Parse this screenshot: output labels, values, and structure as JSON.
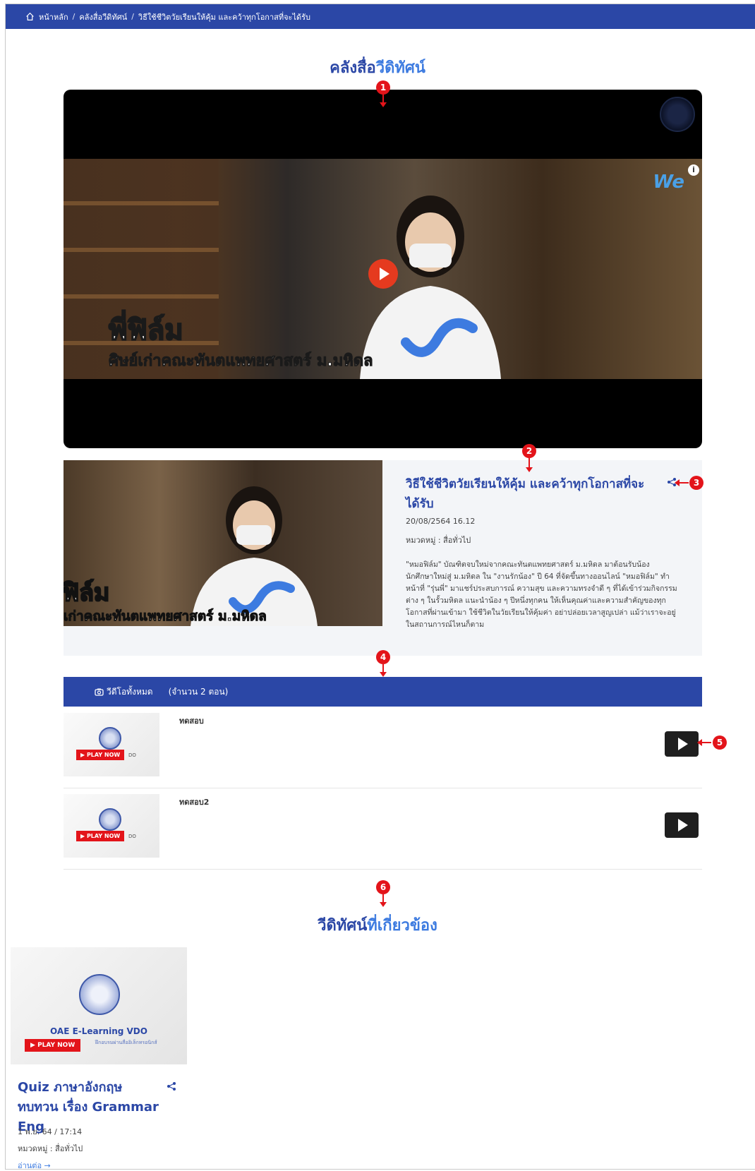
{
  "breadcrumb": {
    "home": "หน้าหลัก",
    "separator": "/",
    "library": "คลังสื่อวีดิทัศน์",
    "current": "วิธีใช้ชีวิตวัยเรียนให้คุ้ม และคว้าทุกโอกาสที่จะได้รับ"
  },
  "page_heading": {
    "part1": "คลังสื่อ",
    "part2": "วีดิทัศน์"
  },
  "player": {
    "caption_line1": "พี่ฟิล์ม",
    "caption_line2": "ศิษย์เก่าคณะทันตแพทยศาสตร์ ม.มหิดล",
    "brand": "We",
    "info": "i"
  },
  "video_detail": {
    "title": "วิธีใช้ชีวิตวัยเรียนให้คุ้ม และคว้าทุกโอกาสที่จะได้รับ",
    "date": "20/08/2564 16.12",
    "category": "หมวดหมู่ : สื่อทั่วไป",
    "description": "\"หมอฟิล์ม\" บัณฑิตจบใหม่จากคณะทันตแพทยศาสตร์ ม.มหิดล มาต้อนรับน้องนักศึกษาใหม่สู่ ม.มหิดล ใน \"งานรักน้อง\" ปี 64 ที่จัดขึ้นทางออนไลน์ \"หมอฟิล์ม\" ทำหน้าที่ \"รุ่นพี่\" มาแชร์ประสบการณ์ ความสุข และความทรงจำดี ๆ ที่ได้เข้าร่วมกิจกรรมต่าง ๆ ในรั้วมหิดล แนะนำน้อง ๆ ปีหนึ่งทุกคน ให้เห็นคุณค่าและความสำคัญของทุกโอกาสที่ผ่านเข้ามา ใช้ชีวิตในวัยเรียนให้คุ้มค่า อย่าปล่อยเวลาสูญเปล่า แม้ว่าเราจะอยู่ในสถานการณ์ไหนก็ตาม",
    "thumb_caption1": "ฟิล์ม",
    "thumb_caption2": "เก่าคณะทันตแพทยศาสตร์ ม.มหิดล"
  },
  "episode_list": {
    "header": "วีดีโอทั้งหมด",
    "count": "(จำนวน 2 ตอน)",
    "items": [
      {
        "title": "ทดสอบ",
        "badge": "PLAY NOW",
        "tag": "DO"
      },
      {
        "title": "ทดสอบ2",
        "badge": "PLAY NOW",
        "tag": "DO"
      }
    ]
  },
  "related": {
    "heading_part1": "วีดิทัศน์",
    "heading_part2": "ที่เกี่ยวข้อง",
    "cards": [
      {
        "thumb_title": "OAE E-Learning VDO",
        "thumb_sub": "ฝึกอบรมผ่านสื่ออิเล็กทรอนิกส์",
        "badge": "PLAY NOW",
        "title": "Quiz ภาษาอังกฤษ ทบทวน เรื่อง Grammar Eng",
        "date": "1 พ.ย. 64 / 17:14",
        "category": "หมวดหมู่ : สื่อทั่วไป",
        "more": "อ่านต่อ →"
      }
    ]
  },
  "markers": [
    "1",
    "2",
    "3",
    "4",
    "5",
    "6"
  ],
  "colors": {
    "primary": "#2b47a6",
    "accent": "#3d7be0",
    "marker": "#e3141a",
    "play": "#e53a1f"
  }
}
